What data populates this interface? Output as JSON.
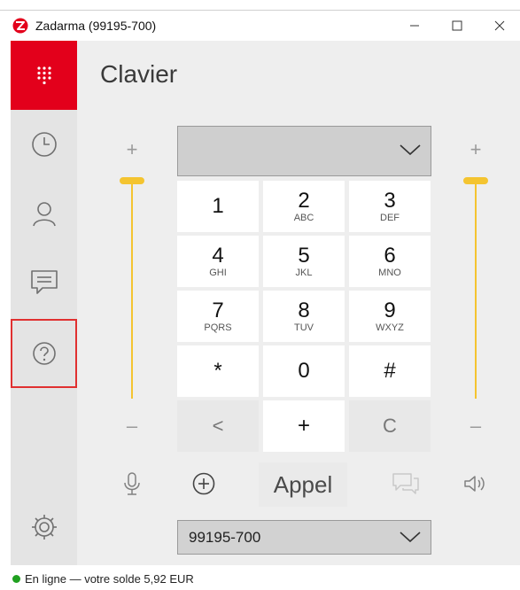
{
  "window": {
    "title": "Zadarma (99195-700)",
    "minimize_icon": "minimize-icon",
    "maximize_icon": "maximize-icon",
    "close_icon": "close-icon"
  },
  "colors": {
    "brand_red": "#e3001b",
    "volume_yellow": "#f4c430",
    "online_green": "#20a020",
    "help_highlight": "#e03030"
  },
  "sidebar": {
    "items": [
      {
        "id": "keypad",
        "icon": "keypad-icon",
        "active": true
      },
      {
        "id": "history",
        "icon": "clock-icon",
        "active": false
      },
      {
        "id": "contacts",
        "icon": "person-icon",
        "active": false
      },
      {
        "id": "messages",
        "icon": "chat-icon",
        "active": false
      },
      {
        "id": "help",
        "icon": "question-icon",
        "active": false,
        "highlighted": true
      },
      {
        "id": "settings",
        "icon": "gear-icon",
        "active": false
      }
    ]
  },
  "page": {
    "title": "Clavier"
  },
  "volume": {
    "left": {
      "plus": "+",
      "minus": "–",
      "level": 1.0
    },
    "right": {
      "plus": "+",
      "minus": "–",
      "level": 1.0
    }
  },
  "keypad": {
    "keys": [
      {
        "digit": "1",
        "letters": ""
      },
      {
        "digit": "2",
        "letters": "ABC"
      },
      {
        "digit": "3",
        "letters": "DEF"
      },
      {
        "digit": "4",
        "letters": "GHI"
      },
      {
        "digit": "5",
        "letters": "JKL"
      },
      {
        "digit": "6",
        "letters": "MNO"
      },
      {
        "digit": "7",
        "letters": "PQRS"
      },
      {
        "digit": "8",
        "letters": "TUV"
      },
      {
        "digit": "9",
        "letters": "WXYZ"
      },
      {
        "digit": "*",
        "letters": ""
      },
      {
        "digit": "0",
        "letters": ""
      },
      {
        "digit": "#",
        "letters": ""
      }
    ],
    "backspace": "<",
    "plus": "+",
    "clear": "C"
  },
  "actions": {
    "call_label": "Appel",
    "microphone_icon": "microphone-icon",
    "add_icon": "add-circle-icon",
    "message_icon": "chat-bubbles-icon",
    "speaker_icon": "speaker-icon"
  },
  "number_select": {
    "value": "99195-700"
  },
  "status": {
    "text": "En ligne — votre solde 5,92 EUR"
  }
}
